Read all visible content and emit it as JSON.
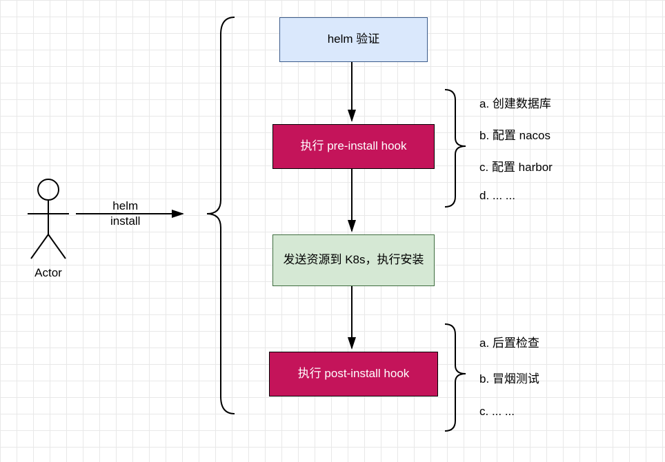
{
  "actor": {
    "label": "Actor"
  },
  "edge_label": "helm\ninstall",
  "steps": {
    "s1": "helm 验证",
    "s2": "执行 pre-install hook",
    "s3": "发送资源到 K8s，执行安装",
    "s4": "执行 post-install hook"
  },
  "side_pre": {
    "a": "a. 创建数据库",
    "b": "b. 配置 nacos",
    "c": "c. 配置 harbor",
    "d": "d. ... ..."
  },
  "side_post": {
    "a": "a. 后置检查",
    "b": "b. 冒烟测试",
    "c": "c. ... ..."
  }
}
